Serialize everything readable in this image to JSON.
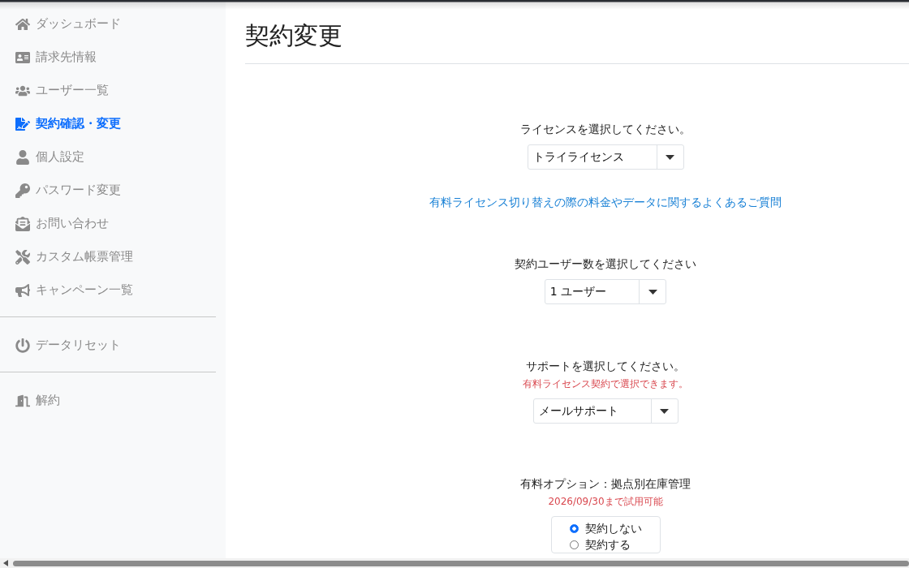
{
  "sidebar": {
    "sections": [
      {
        "items": [
          {
            "label": "ダッシュボード",
            "selected": false
          },
          {
            "label": "請求先情報",
            "selected": false
          },
          {
            "label": "ユーザー一覧",
            "selected": false
          },
          {
            "label": "契約確認・変更",
            "selected": true
          },
          {
            "label": "個人設定",
            "selected": false
          },
          {
            "label": "パスワード変更",
            "selected": false
          },
          {
            "label": "お問い合わせ",
            "selected": false
          },
          {
            "label": "カスタム帳票管理",
            "selected": false
          },
          {
            "label": "キャンペーン一覧",
            "selected": false
          }
        ]
      },
      {
        "items": [
          {
            "label": "データリセット",
            "selected": false
          }
        ]
      },
      {
        "items": [
          {
            "label": "解約",
            "selected": false
          }
        ]
      }
    ]
  },
  "page": {
    "title": "契約変更"
  },
  "form": [
    {
      "kind": "select",
      "label": "ライセンスを選択してください。",
      "value": "トライライセンス"
    },
    {
      "kind": "link",
      "text": "有料ライセンス切り替えの際の料金やデータに関するよくあるご質問"
    },
    {
      "kind": "select",
      "label": "契約ユーザー数を選択してください",
      "value": "1 ユーザー"
    },
    {
      "kind": "select",
      "label": "サポートを選択してください。",
      "note": "有料ライセンス契約で選択できます。",
      "value": "メールサポート"
    },
    {
      "kind": "radio",
      "label": "有料オプション：拠点別在庫管理",
      "note": "2026/09/30まで試用可能",
      "options": [
        {
          "label": "契約しない",
          "selected": true
        },
        {
          "label": "契約する",
          "selected": false
        }
      ]
    }
  ]
}
